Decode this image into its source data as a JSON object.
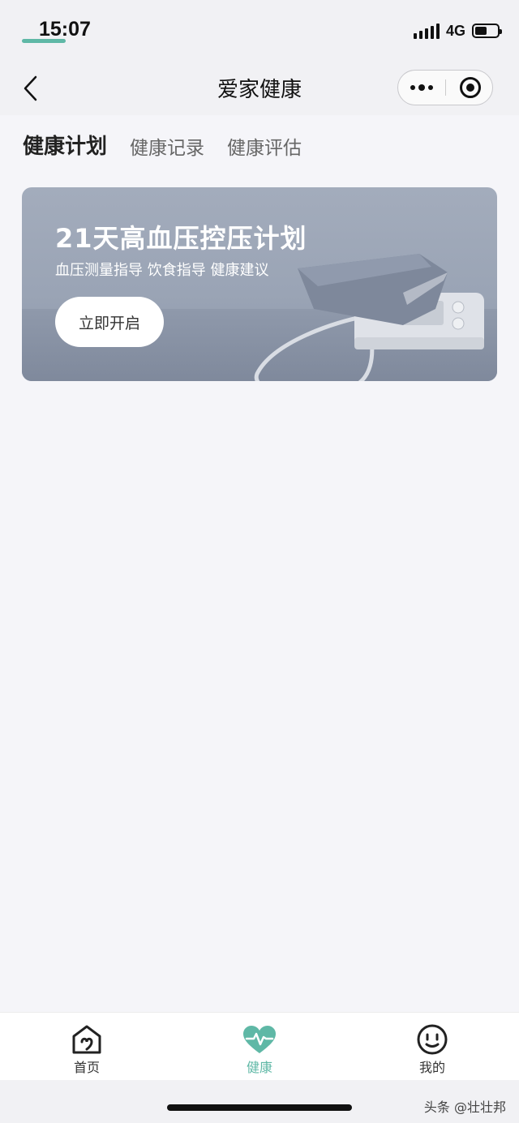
{
  "status_bar": {
    "time": "15:07",
    "network": "4G",
    "battery_level": 0.55
  },
  "nav": {
    "title": "爱家健康"
  },
  "tabs": [
    {
      "label": "健康计划",
      "active": true
    },
    {
      "label": "健康记录",
      "active": false
    },
    {
      "label": "健康评估",
      "active": false
    }
  ],
  "banner": {
    "title": "21天高血压控压计划",
    "subtitle": "血压测量指导 饮食指导 健康建议",
    "button_label": "立即开启"
  },
  "tabbar": {
    "items": [
      {
        "label": "首页",
        "icon": "home-icon",
        "active": false
      },
      {
        "label": "健康",
        "icon": "heartbeat-icon",
        "active": true
      },
      {
        "label": "我的",
        "icon": "smiley-icon",
        "active": false
      }
    ]
  },
  "watermark": "头条 @壮壮邦",
  "colors": {
    "accent": "#5fb8a6",
    "background": "#f5f5f9"
  }
}
